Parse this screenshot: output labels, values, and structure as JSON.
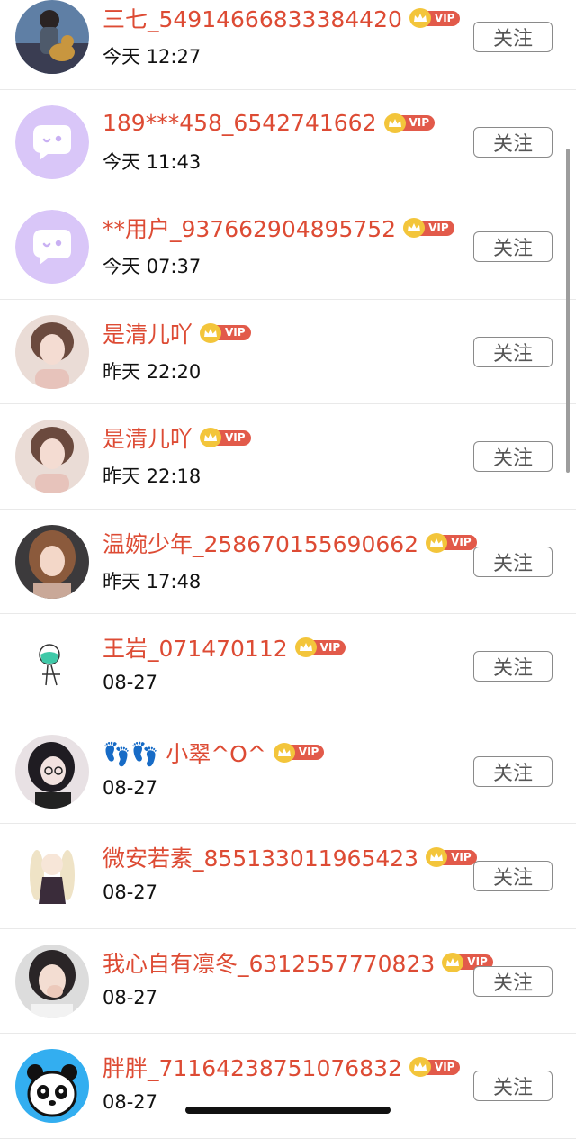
{
  "list": {
    "follow_label": "关注",
    "vip_label": "VIP",
    "items": [
      {
        "name": "三七_54914666833384420",
        "time": "今天 12:27",
        "vip": true,
        "avatar": "photo-girl-with-dog"
      },
      {
        "name": "189***458_6542741662",
        "time": "今天 11:43",
        "vip": true,
        "avatar": "default-chat-bubble"
      },
      {
        "name": "**用户_937662904895752",
        "time": "今天 07:37",
        "vip": true,
        "avatar": "default-chat-bubble"
      },
      {
        "name": "是清儿吖",
        "time": "昨天 22:20",
        "vip": true,
        "avatar": "photo-girl-portrait"
      },
      {
        "name": "是清儿吖",
        "time": "昨天 22:18",
        "vip": true,
        "avatar": "photo-girl-portrait"
      },
      {
        "name": "温婉少年_258670155690662",
        "time": "昨天 17:48",
        "vip": true,
        "avatar": "photo-girl-brown-hair"
      },
      {
        "name": "王岩_071470112",
        "time": "08-27",
        "vip": true,
        "avatar": "drawing-sketch-figure"
      },
      {
        "name": "👣👣 小翠^O^",
        "time": "08-27",
        "vip": true,
        "avatar": "photo-girl-glasses"
      },
      {
        "name": "微安若素_855133011965423",
        "time": "08-27",
        "vip": true,
        "avatar": "anime-illustration"
      },
      {
        "name": "我心自有凛冬_6312557770823",
        "time": "08-27",
        "vip": true,
        "avatar": "photo-girl-hand-face"
      },
      {
        "name": "胖胖_71164238751076832",
        "time": "08-27",
        "vip": true,
        "avatar": "panda-pixel-art"
      }
    ]
  },
  "colors": {
    "name": "#dd4b34",
    "vip_tag": "#e25a4a",
    "vip_crown": "#f3c53b",
    "default_avatar": "#d7c4f7"
  }
}
